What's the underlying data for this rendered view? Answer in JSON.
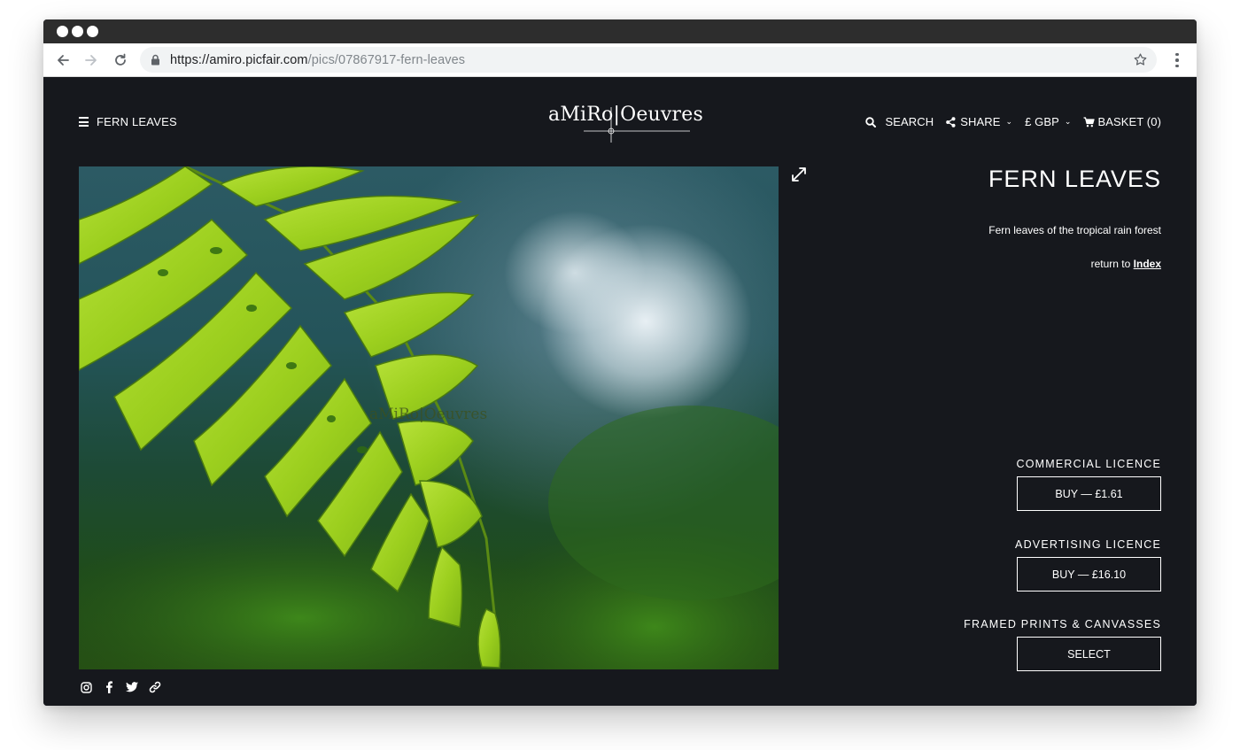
{
  "browser": {
    "url_scheme_host": "https://amiro.picfair.com",
    "url_path": "/pics/07867917-fern-leaves"
  },
  "header": {
    "menu_label": "FERN LEAVES",
    "logo_text": "aMiRo|Oeuvres",
    "search_label": "SEARCH",
    "share_label": "SHARE",
    "currency_label": "£ GBP",
    "basket_label": "BASKET (0)"
  },
  "photo": {
    "watermark": "aMiRo|Oeuvres"
  },
  "info": {
    "title": "FERN LEAVES",
    "description": "Fern leaves of the tropical rain forest",
    "return_prefix": "return to",
    "return_link": "Index"
  },
  "licences": [
    {
      "heading": "COMMERCIAL LICENCE",
      "button": "BUY — £1.61"
    },
    {
      "heading": "ADVERTISING LICENCE",
      "button": "BUY — £16.10"
    },
    {
      "heading": "FRAMED PRINTS & CANVASSES",
      "button": "SELECT"
    }
  ],
  "socials": [
    "instagram-icon",
    "facebook-icon",
    "twitter-icon",
    "link-icon"
  ],
  "colors": {
    "page_background": "#16181d",
    "text": "#ffffff",
    "titlebar": "#2d2d2d"
  }
}
